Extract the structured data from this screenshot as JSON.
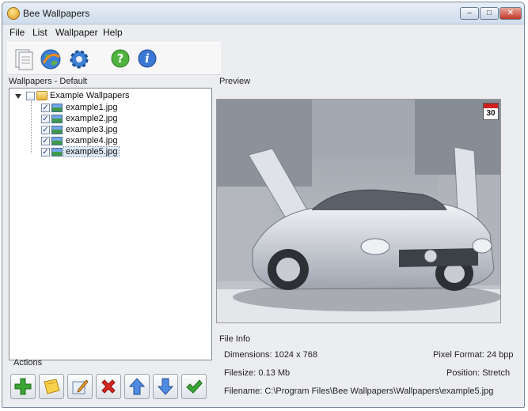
{
  "window": {
    "title": "Bee Wallpapers"
  },
  "titlebar_buttons": {
    "minimize": "–",
    "maximize": "□",
    "close": "✕"
  },
  "menu": [
    "File",
    "List",
    "Wallpaper",
    "Help"
  ],
  "toolbar": {
    "icons": [
      "new-list-icon",
      "globe-icon",
      "settings-gear-icon",
      "help-icon",
      "info-icon"
    ]
  },
  "wallpapers_panel": {
    "label": "Wallpapers - Default",
    "root": {
      "label": "Example Wallpapers",
      "checked": false
    },
    "items": [
      {
        "label": "example1.jpg",
        "checked": true
      },
      {
        "label": "example2.jpg",
        "checked": true
      },
      {
        "label": "example3.jpg",
        "checked": true
      },
      {
        "label": "example4.jpg",
        "checked": true
      },
      {
        "label": "example5.jpg",
        "checked": true
      }
    ]
  },
  "preview": {
    "label": "Preview",
    "calendar_badge": "30"
  },
  "file_info": {
    "label": "File Info",
    "dimensions": "Dimensions: 1024 x 768",
    "pixel_format": "Pixel Format: 24 bpp",
    "filesize": "Filesize: 0.13 Mb",
    "position": "Position: Stretch",
    "filename": "Filename: C:\\Program Files\\Bee Wallpapers\\Wallpapers\\example5.jpg"
  },
  "actions": {
    "label": "Actions",
    "buttons": [
      "add-icon",
      "add-folder-icon",
      "edit-icon",
      "delete-icon",
      "move-up-icon",
      "move-down-icon",
      "apply-check-icon"
    ]
  }
}
